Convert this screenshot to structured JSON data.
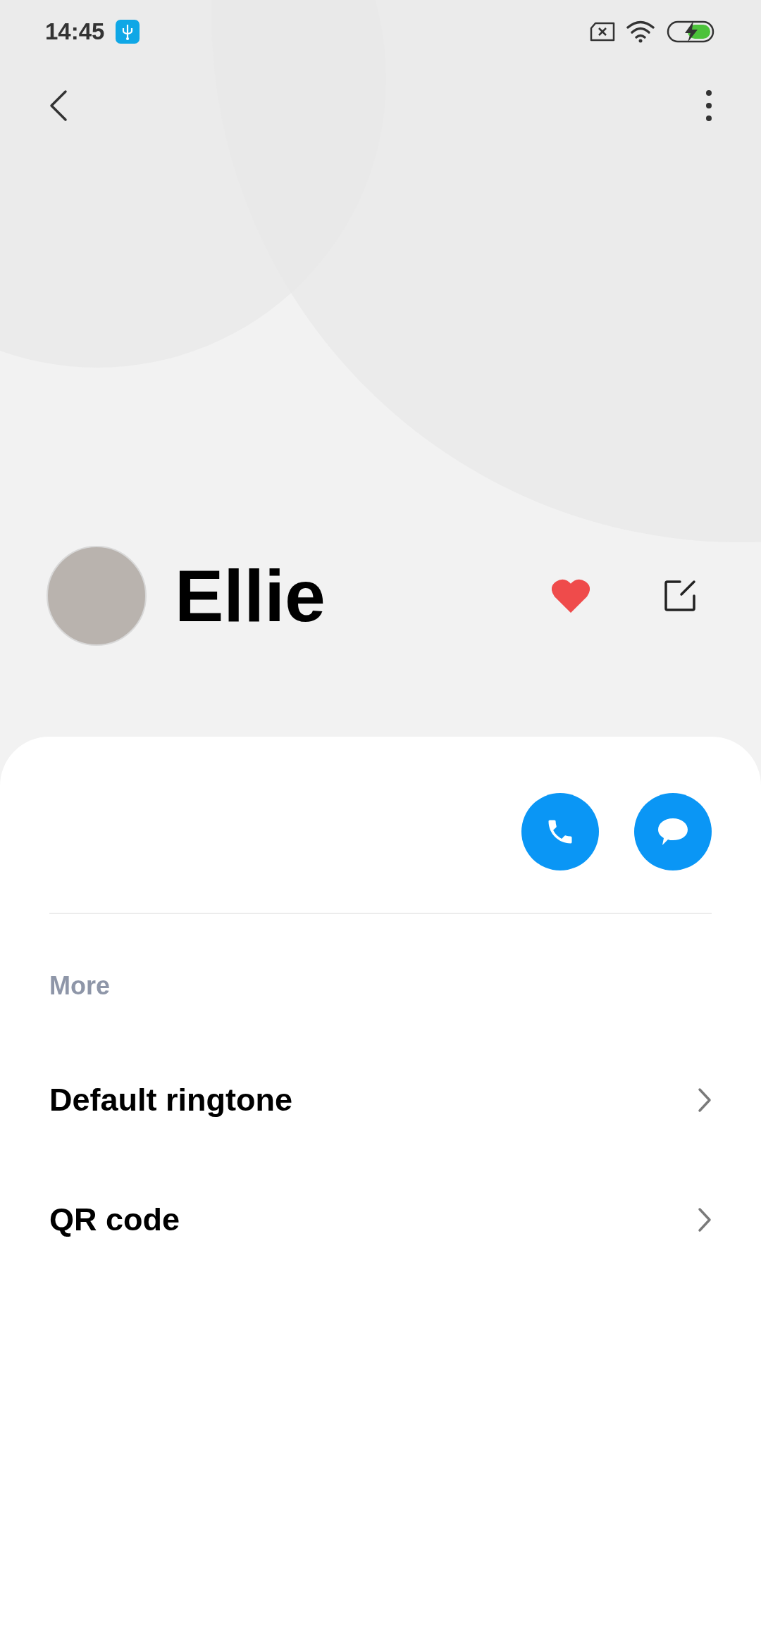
{
  "status_bar": {
    "time": "14:45"
  },
  "contact": {
    "name": "Ellie",
    "favorite": true
  },
  "section": {
    "title": "More"
  },
  "items": [
    {
      "label": "Default ringtone"
    },
    {
      "label": "QR code"
    }
  ]
}
